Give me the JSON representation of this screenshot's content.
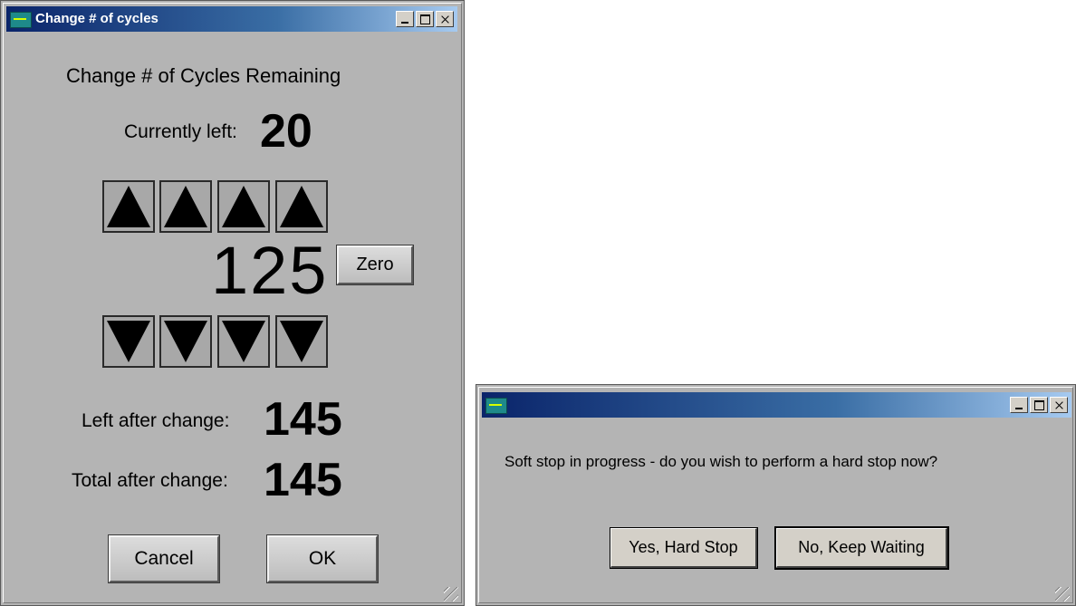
{
  "cycles_dialog": {
    "title": "Change # of cycles",
    "heading": "Change # of Cycles Remaining",
    "currently_left_label": "Currently left:",
    "currently_left_value": "20",
    "change_value": "125",
    "zero_label": "Zero",
    "left_after_label": "Left after change:",
    "left_after_value": "145",
    "total_after_label": "Total after change:",
    "total_after_value": "145",
    "cancel_label": "Cancel",
    "ok_label": "OK",
    "up_arrows": [
      "arrow-up-icon",
      "arrow-up-icon",
      "arrow-up-icon",
      "arrow-up-icon"
    ],
    "down_arrows": [
      "arrow-down-icon",
      "arrow-down-icon",
      "arrow-down-icon",
      "arrow-down-icon"
    ]
  },
  "stop_dialog": {
    "title": "",
    "message": "Soft stop in progress - do you wish to perform a hard stop now?",
    "yes_label": "Yes, Hard Stop",
    "no_label": "No, Keep Waiting"
  },
  "colors": {
    "window_bg": "#b4b4b4",
    "titlebar_start": "#0a246a",
    "titlebar_end": "#a6caf0",
    "app_icon": "#1e8a8a"
  }
}
